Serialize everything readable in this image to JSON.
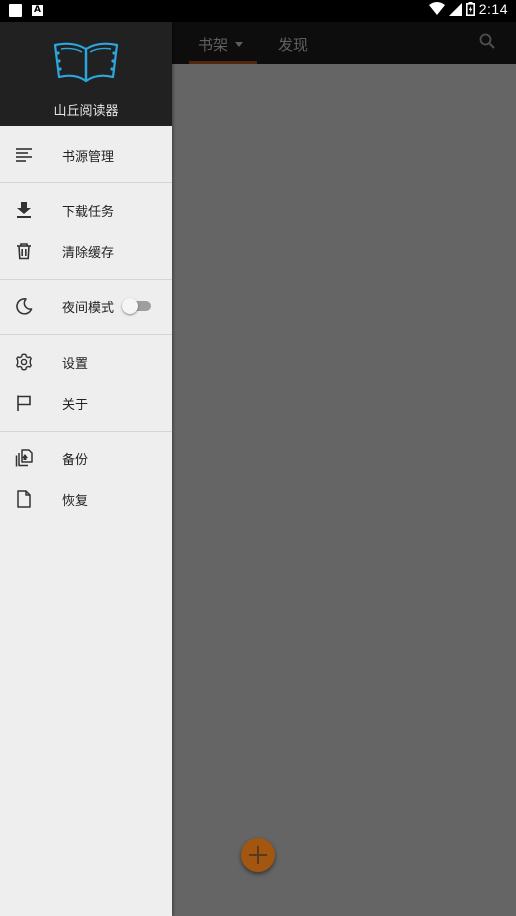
{
  "status_bar": {
    "time": "2:14"
  },
  "app": {
    "tabs": [
      {
        "label": "书架"
      },
      {
        "label": "发现"
      }
    ]
  },
  "drawer": {
    "app_name": "山丘阅读器",
    "items": [
      {
        "label": "书源管理",
        "icon": "list-icon"
      },
      {
        "label": "下载任务",
        "icon": "download-icon"
      },
      {
        "label": "清除缓存",
        "icon": "trash-icon"
      },
      {
        "label": "夜间模式",
        "icon": "moon-icon",
        "toggle": false
      },
      {
        "label": "设置",
        "icon": "gear-icon"
      },
      {
        "label": "关于",
        "icon": "flag-icon"
      },
      {
        "label": "备份",
        "icon": "backup-icon"
      },
      {
        "label": "恢复",
        "icon": "file-icon"
      }
    ]
  },
  "colors": {
    "accent": "#c15b1e",
    "fab": "#a3560f",
    "header": "#212121"
  }
}
